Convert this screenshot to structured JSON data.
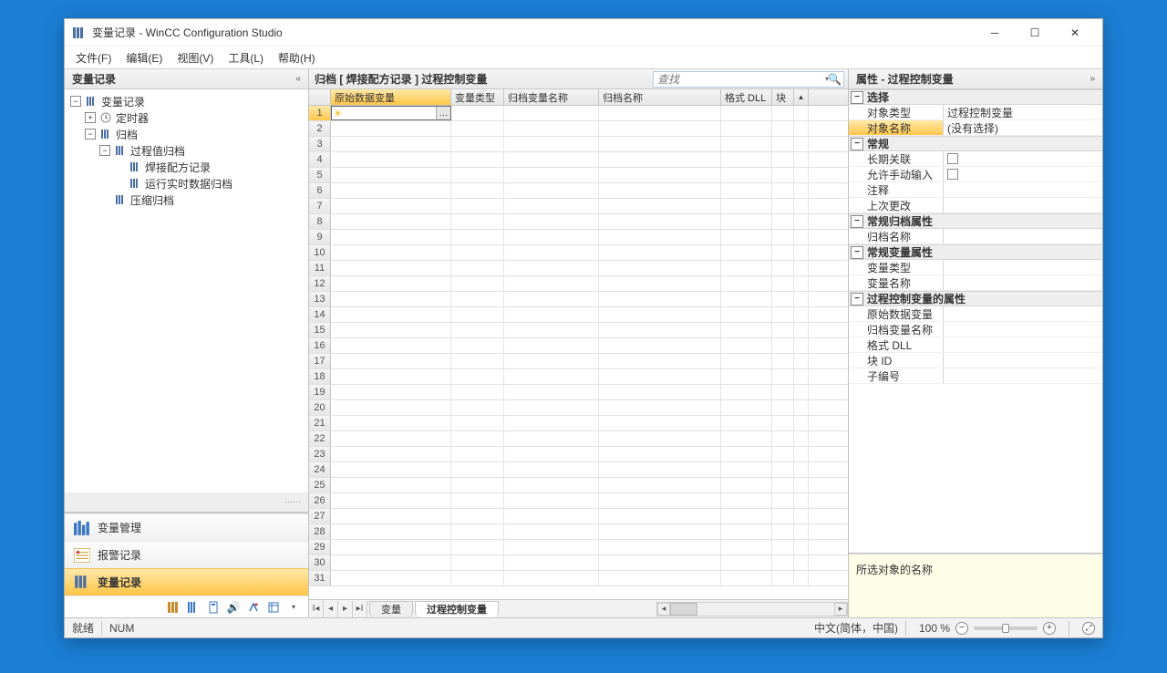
{
  "window": {
    "title": "变量记录 - WinCC Configuration Studio"
  },
  "menu": {
    "file": "文件(F)",
    "edit": "编辑(E)",
    "view": "视图(V)",
    "tools": "工具(L)",
    "help": "帮助(H)"
  },
  "leftPanel": {
    "title": "变量记录",
    "tree": {
      "root": "变量记录",
      "timer": "定时器",
      "archive": "归档",
      "procArchive": "过程值归档",
      "weldRecipe": "焊接配方记录",
      "runtimeData": "运行实时数据归档",
      "compressed": "压缩归档"
    },
    "nav": {
      "tagMgmt": "变量管理",
      "alarm": "报警记录",
      "tagLog": "变量记录"
    }
  },
  "center": {
    "heading": "归档 [  焊接配方记录  ]  过程控制变量",
    "searchPlaceholder": "查找",
    "columns": {
      "c1": "原始数据变量",
      "c2": "变量类型",
      "c3": "归档变量名称",
      "c4": "归档名称",
      "c5": "格式 DLL",
      "c6": "块"
    },
    "rowCount": 31,
    "tabs": {
      "t1": "变量",
      "t2": "过程控制变量"
    }
  },
  "right": {
    "title": "属性 - 过程控制变量",
    "groups": {
      "selection": {
        "label": "选择",
        "objType": {
          "n": "对象类型",
          "v": "过程控制变量"
        },
        "objName": {
          "n": "对象名称",
          "v": "(没有选择)"
        }
      },
      "general": {
        "label": "常规",
        "longTerm": {
          "n": "长期关联"
        },
        "manualInput": {
          "n": "允许手动输入"
        },
        "comment": {
          "n": "注释"
        },
        "lastChange": {
          "n": "上次更改"
        }
      },
      "archProps": {
        "label": "常规归档属性",
        "archName": {
          "n": "归档名称"
        }
      },
      "tagProps": {
        "label": "常规变量属性",
        "tagType": {
          "n": "变量类型"
        },
        "tagName": {
          "n": "变量名称"
        }
      },
      "pcProps": {
        "label": "过程控制变量的属性",
        "rawTag": {
          "n": "原始数据变量"
        },
        "archTagName": {
          "n": "归档变量名称"
        },
        "formatDll": {
          "n": "格式 DLL"
        },
        "blockId": {
          "n": "块 ID"
        },
        "subNum": {
          "n": "子编号"
        }
      }
    },
    "desc": "所选对象的名称"
  },
  "status": {
    "ready": "就绪",
    "num": "NUM",
    "lang": "中文(简体，中国)",
    "zoom": "100 %"
  }
}
